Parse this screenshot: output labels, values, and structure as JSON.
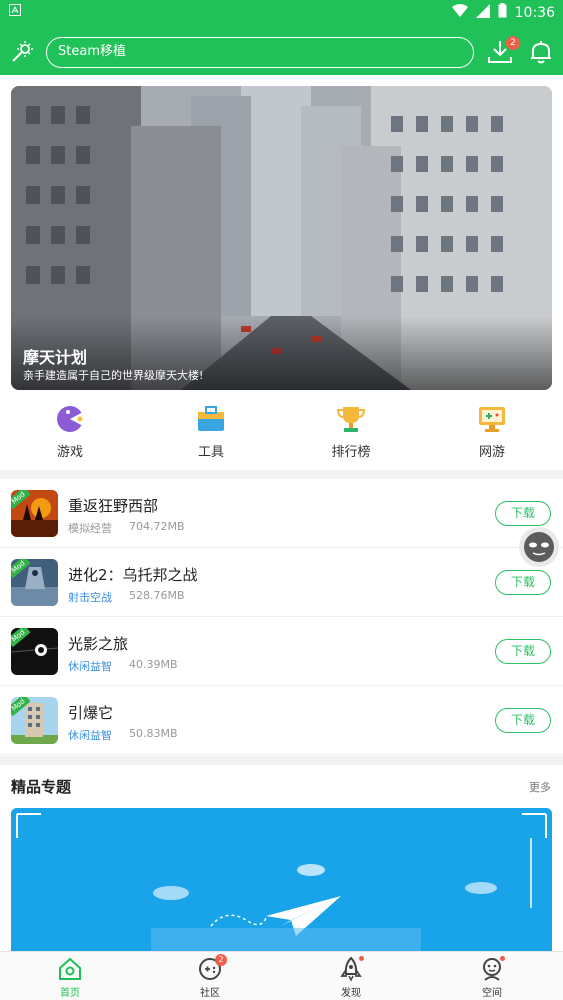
{
  "status_bar": {
    "time": "10:36"
  },
  "search": {
    "placeholder": "Steam移植"
  },
  "header": {
    "download_badge": "2"
  },
  "banner": {
    "title": "摩天计划",
    "subtitle": "亲手建造属于自己的世界级摩天大楼!"
  },
  "quick_nav": [
    {
      "label": "游戏",
      "icon": "game-pacman-icon"
    },
    {
      "label": "工具",
      "icon": "toolbox-icon"
    },
    {
      "label": "排行榜",
      "icon": "trophy-icon"
    },
    {
      "label": "网游",
      "icon": "gamepad-screen-icon"
    }
  ],
  "apps": [
    {
      "name": "重返狂野西部",
      "category": "模拟经营",
      "size": "704.72MB",
      "button": "下载",
      "mod": "Mod",
      "category_color": "#999999"
    },
    {
      "name": "进化2：乌托邦之战",
      "category": "射击空战",
      "size": "528.76MB",
      "button": "下载",
      "mod": "Mod",
      "category_color": "#3c8fe0"
    },
    {
      "name": "光影之旅",
      "category": "休闲益智",
      "size": "40.39MB",
      "button": "下载",
      "mod": "Mod",
      "category_color": "#3c8fe0"
    },
    {
      "name": "引爆它",
      "category": "休闲益智",
      "size": "50.83MB",
      "button": "下载",
      "mod": "Mod",
      "category_color": "#3c8fe0"
    }
  ],
  "section": {
    "title": "精品专题",
    "more": "更多"
  },
  "bottom_nav": [
    {
      "label": "首页",
      "active": true
    },
    {
      "label": "社区",
      "badge": "2"
    },
    {
      "label": "发现"
    },
    {
      "label": "空间"
    }
  ],
  "colors": {
    "brand": "#1fc158",
    "accent": "#2cc066",
    "badge": "#f25c4a"
  }
}
